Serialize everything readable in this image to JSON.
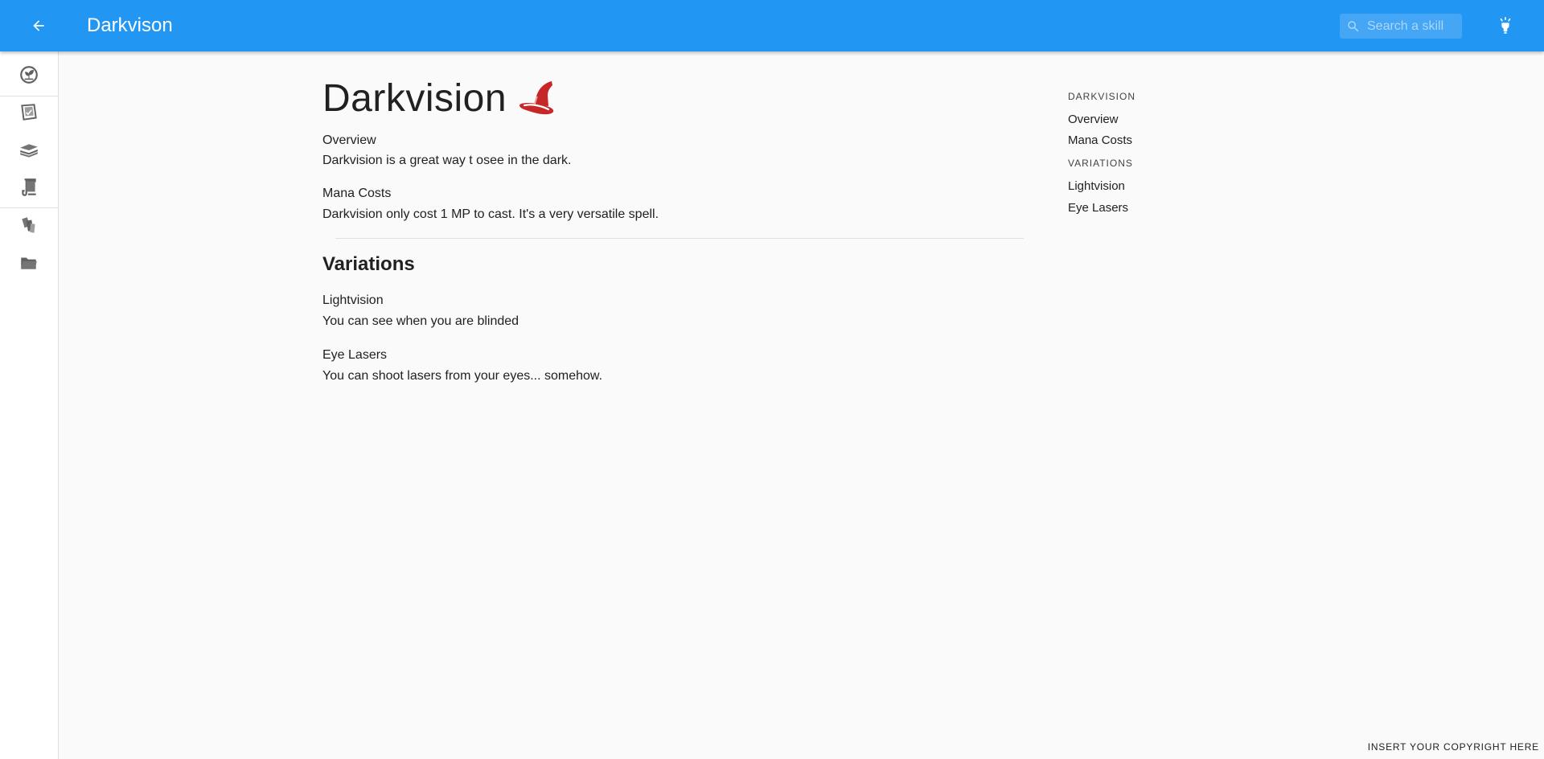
{
  "appbar": {
    "title": "Darkvison",
    "search_placeholder": "Search a skill",
    "back_icon": "arrow-left-icon",
    "theme_icon": "lightbulb-icon",
    "color": "#2196f3"
  },
  "siderail": {
    "items": [
      {
        "icon": "sprout-circle-icon"
      },
      {
        "icon": "notebook-icon"
      },
      {
        "icon": "book-stack-icon"
      },
      {
        "icon": "scroll-icon"
      },
      {
        "icon": "cards-icon"
      },
      {
        "icon": "folder-icon"
      }
    ]
  },
  "page": {
    "title": "Darkvision",
    "title_icon": "wizard-hat-icon",
    "overview": {
      "heading": "Overview",
      "body": "Darkvision is a great way t osee in the dark."
    },
    "mana": {
      "heading": "Mana Costs",
      "body": "Darkvision only cost 1 MP to cast. It's a very versatile spell."
    },
    "variations": {
      "title": "Variations",
      "items": [
        {
          "heading": "Lightvision",
          "body": "You can see when you are blinded"
        },
        {
          "heading": "Eye Lasers",
          "body": "You can shoot lasers from your eyes... somehow."
        }
      ]
    }
  },
  "toc": {
    "section1": "DARKVISION",
    "links1": [
      "Overview",
      "Mana Costs"
    ],
    "section2": "VARIATIONS",
    "links2": [
      "Lightvision",
      "Eye Lasers"
    ]
  },
  "footer": {
    "copyright": "INSERT YOUR COPYRIGHT HERE"
  }
}
